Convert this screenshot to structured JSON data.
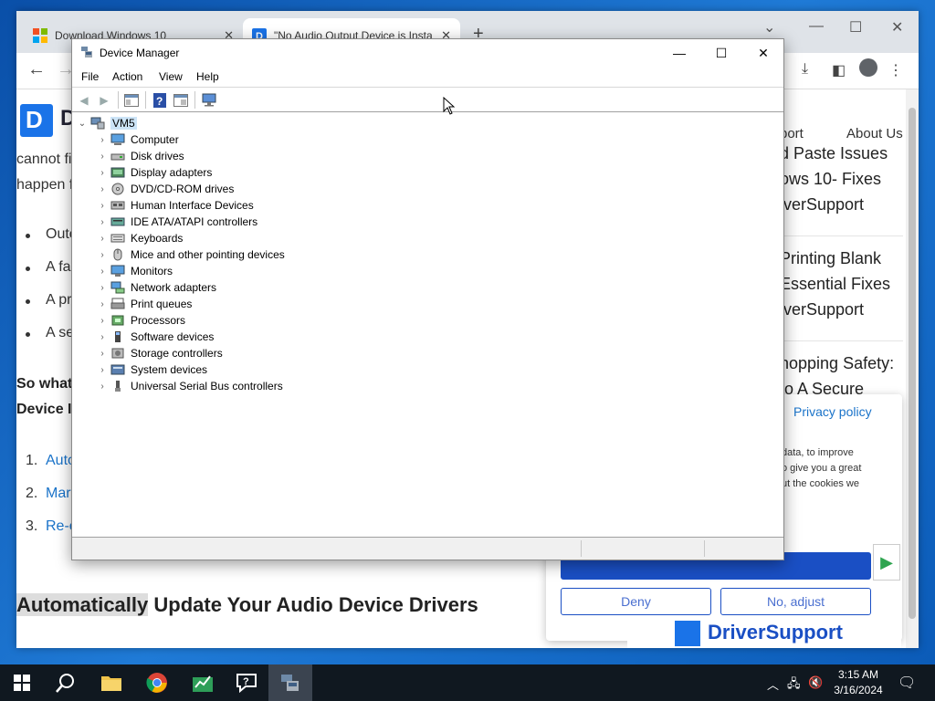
{
  "browser": {
    "tabs": [
      {
        "title": "Download Windows 10"
      },
      {
        "title": "\"No Audio Output Device is Insta"
      }
    ],
    "new_tab": "+"
  },
  "webpage": {
    "logo_letter": "D",
    "logo_text": "D",
    "intro_lines": [
      "cannot fi",
      "happen f"
    ],
    "bullets": [
      "Outc",
      "A fa",
      "A pr",
      "A se"
    ],
    "question_lines": [
      "So what",
      "Device In"
    ],
    "numbered": [
      {
        "num": "1.",
        "text": "Auto"
      },
      {
        "num": "2.",
        "text": "Mar"
      },
      {
        "num": "3.",
        "text": "Re-e"
      }
    ],
    "headline_highlight": "Automatically",
    "headline_rest": " Update Your Audio Device Drivers",
    "nav": {
      "support": "port",
      "about": "About Us"
    },
    "sidebar": [
      "d Paste Issues",
      "ows 10- Fixes",
      "iverSupport",
      "Printing Blank",
      "Essential Fixes",
      "iverSupport",
      "hopping Safety:",
      "to A Secure"
    ],
    "cookie": {
      "privacy": "Privacy policy",
      "text_lines": [
        "data, to improve",
        "o give you a great",
        "ut the cookies we"
      ],
      "deny": "Deny",
      "adjust": "No, adjust"
    },
    "footer_brand": "DriverSupport"
  },
  "device_manager": {
    "title": "Device Manager",
    "menu": [
      "File",
      "Action",
      "View",
      "Help"
    ],
    "root": "VM5",
    "categories": [
      "Computer",
      "Disk drives",
      "Display adapters",
      "DVD/CD-ROM drives",
      "Human Interface Devices",
      "IDE ATA/ATAPI controllers",
      "Keyboards",
      "Mice and other pointing devices",
      "Monitors",
      "Network adapters",
      "Print queues",
      "Processors",
      "Software devices",
      "Storage controllers",
      "System devices",
      "Universal Serial Bus controllers"
    ]
  },
  "taskbar": {
    "time": "3:15 AM",
    "date": "3/16/2024"
  },
  "colors": {
    "accent": "#1a73c9",
    "selection": "#cce4f7",
    "taskbar": "#101820"
  }
}
